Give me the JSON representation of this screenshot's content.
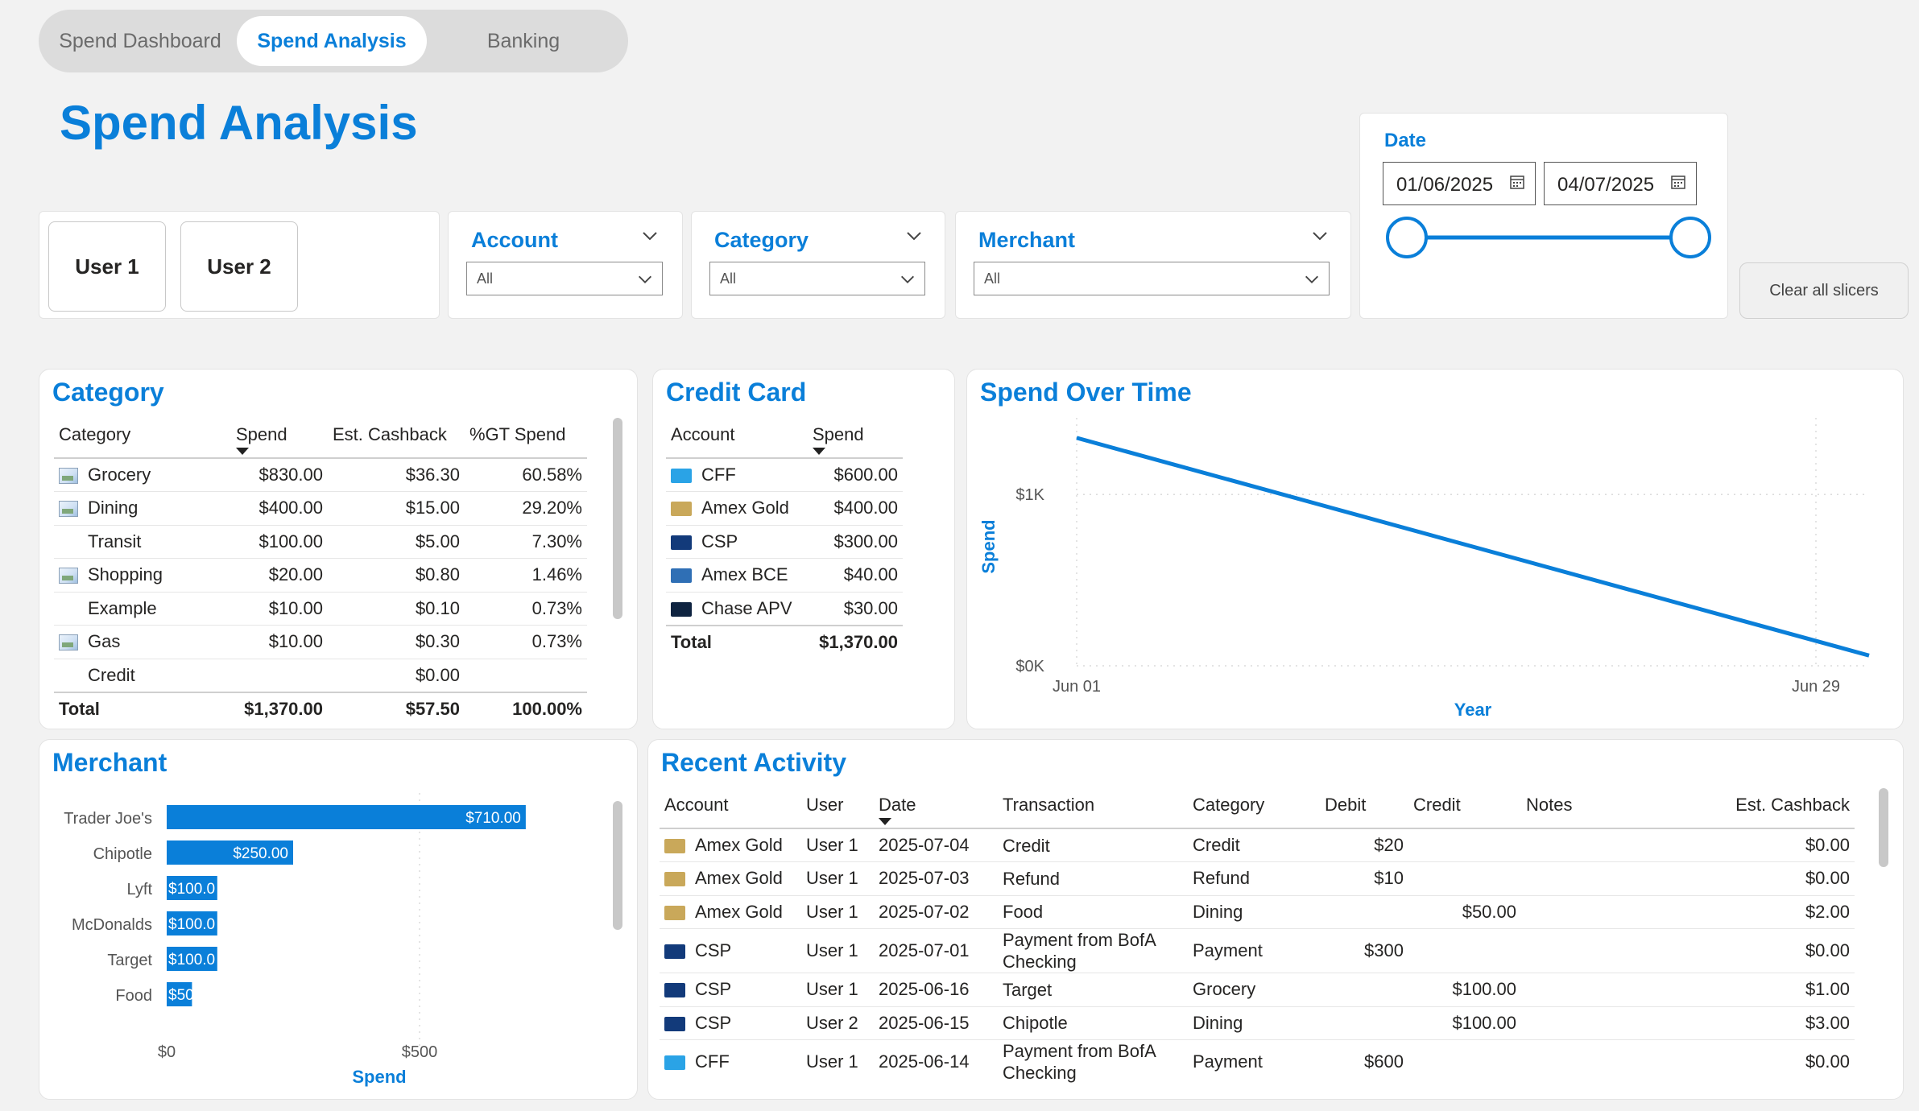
{
  "nav": {
    "tabs": [
      {
        "label": "Spend Dashboard",
        "active": false
      },
      {
        "label": "Spend Analysis",
        "active": true
      },
      {
        "label": "Banking",
        "active": false
      }
    ]
  },
  "page_title": "Spend Analysis",
  "users": [
    "User 1",
    "User 2"
  ],
  "slicers": {
    "account": {
      "title": "Account",
      "value": "All"
    },
    "category": {
      "title": "Category",
      "value": "All"
    },
    "merchant": {
      "title": "Merchant",
      "value": "All"
    },
    "date": {
      "title": "Date",
      "start": "01/06/2025",
      "end": "04/07/2025"
    }
  },
  "clear_button": "Clear all slicers",
  "category_table": {
    "title": "Category",
    "headers": [
      "Category",
      "Spend",
      "Est. Cashback",
      "%GT Spend"
    ],
    "rows": [
      {
        "category": "Grocery",
        "spend": "$830.00",
        "cashback": "$36.30",
        "pct": "60.58%",
        "icon": "image-icon"
      },
      {
        "category": "Dining",
        "spend": "$400.00",
        "cashback": "$15.00",
        "pct": "29.20%",
        "icon": "image-icon"
      },
      {
        "category": "Transit",
        "spend": "$100.00",
        "cashback": "$5.00",
        "pct": "7.30%",
        "icon": ""
      },
      {
        "category": "Shopping",
        "spend": "$20.00",
        "cashback": "$0.80",
        "pct": "1.46%",
        "icon": "image-icon"
      },
      {
        "category": "Example",
        "spend": "$10.00",
        "cashback": "$0.10",
        "pct": "0.73%",
        "icon": ""
      },
      {
        "category": "Gas",
        "spend": "$10.00",
        "cashback": "$0.30",
        "pct": "0.73%",
        "icon": "image-icon"
      },
      {
        "category": "Credit",
        "spend": "",
        "cashback": "$0.00",
        "pct": "",
        "icon": ""
      }
    ],
    "total": {
      "label": "Total",
      "spend": "$1,370.00",
      "cashback": "$57.50",
      "pct": "100.00%"
    }
  },
  "credit_card_table": {
    "title": "Credit Card",
    "headers": [
      "Account",
      "Spend"
    ],
    "rows": [
      {
        "account": "CFF",
        "spend": "$600.00",
        "color": "#2aa3e6"
      },
      {
        "account": "Amex Gold",
        "spend": "$400.00",
        "color": "#c9a85a"
      },
      {
        "account": "CSP",
        "spend": "$300.00",
        "color": "#123a7a"
      },
      {
        "account": "Amex BCE",
        "spend": "$40.00",
        "color": "#2f6fb5"
      },
      {
        "account": "Chase APV",
        "spend": "$30.00",
        "color": "#0e2340"
      }
    ],
    "total": {
      "label": "Total",
      "spend": "$1,370.00"
    }
  },
  "spend_over_time": {
    "title": "Spend Over Time",
    "chart_data": {
      "type": "line",
      "title": "Spend Over Time",
      "xlabel": "Year",
      "ylabel": "Spend",
      "x_ticks": [
        "Jun 01",
        "Jun 29"
      ],
      "y_ticks": [
        "$0K",
        "$1K"
      ],
      "ylim": [
        0,
        1400
      ],
      "series": [
        {
          "x": [
            "2025-06-01",
            "2025-07-04"
          ],
          "values": [
            1330,
            60
          ]
        }
      ],
      "grid": true,
      "color": "#0a7fd9"
    }
  },
  "merchant_chart": {
    "title": "Merchant",
    "chart_data": {
      "type": "bar",
      "orientation": "horizontal",
      "title": "Merchant",
      "xlabel": "Spend",
      "categories": [
        "Trader Joe's",
        "Chipotle",
        "Lyft",
        "McDonalds",
        "Target",
        "Food"
      ],
      "values": [
        710,
        250,
        100,
        100,
        100,
        50
      ],
      "labels": [
        "$710.00",
        "$250.00",
        "$100.0",
        "$100.0",
        "$100.0",
        "$50"
      ],
      "x_ticks": [
        "$0",
        "$500"
      ],
      "xlim": [
        0,
        1000
      ],
      "color": "#0a7fd9"
    }
  },
  "recent_activity": {
    "title": "Recent Activity",
    "headers": [
      "Account",
      "User",
      "Date",
      "Transaction",
      "Category",
      "Debit",
      "Credit",
      "Notes",
      "Est. Cashback"
    ],
    "rows": [
      {
        "account": "Amex Gold",
        "color": "#c9a85a",
        "user": "User 1",
        "date": "2025-07-04",
        "transaction": "Credit",
        "category": "Credit",
        "debit": "$20",
        "credit": "",
        "notes": "",
        "cashback": "$0.00"
      },
      {
        "account": "Amex Gold",
        "color": "#c9a85a",
        "user": "User 1",
        "date": "2025-07-03",
        "transaction": "Refund",
        "category": "Refund",
        "debit": "$10",
        "credit": "",
        "notes": "",
        "cashback": "$0.00"
      },
      {
        "account": "Amex Gold",
        "color": "#c9a85a",
        "user": "User 1",
        "date": "2025-07-02",
        "transaction": "Food",
        "category": "Dining",
        "debit": "",
        "credit": "$50.00",
        "notes": "",
        "cashback": "$2.00"
      },
      {
        "account": "CSP",
        "color": "#123a7a",
        "user": "User 1",
        "date": "2025-07-01",
        "transaction": "Payment from BofA Checking",
        "category": "Payment",
        "debit": "$300",
        "credit": "",
        "notes": "",
        "cashback": "$0.00"
      },
      {
        "account": "CSP",
        "color": "#123a7a",
        "user": "User 1",
        "date": "2025-06-16",
        "transaction": "Target",
        "category": "Grocery",
        "debit": "",
        "credit": "$100.00",
        "notes": "",
        "cashback": "$1.00"
      },
      {
        "account": "CSP",
        "color": "#123a7a",
        "user": "User 2",
        "date": "2025-06-15",
        "transaction": "Chipotle",
        "category": "Dining",
        "debit": "",
        "credit": "$100.00",
        "notes": "",
        "cashback": "$3.00"
      },
      {
        "account": "CFF",
        "color": "#2aa3e6",
        "user": "User 1",
        "date": "2025-06-14",
        "transaction": "Payment from BofA Checking",
        "category": "Payment",
        "debit": "$600",
        "credit": "",
        "notes": "",
        "cashback": "$0.00"
      }
    ]
  }
}
